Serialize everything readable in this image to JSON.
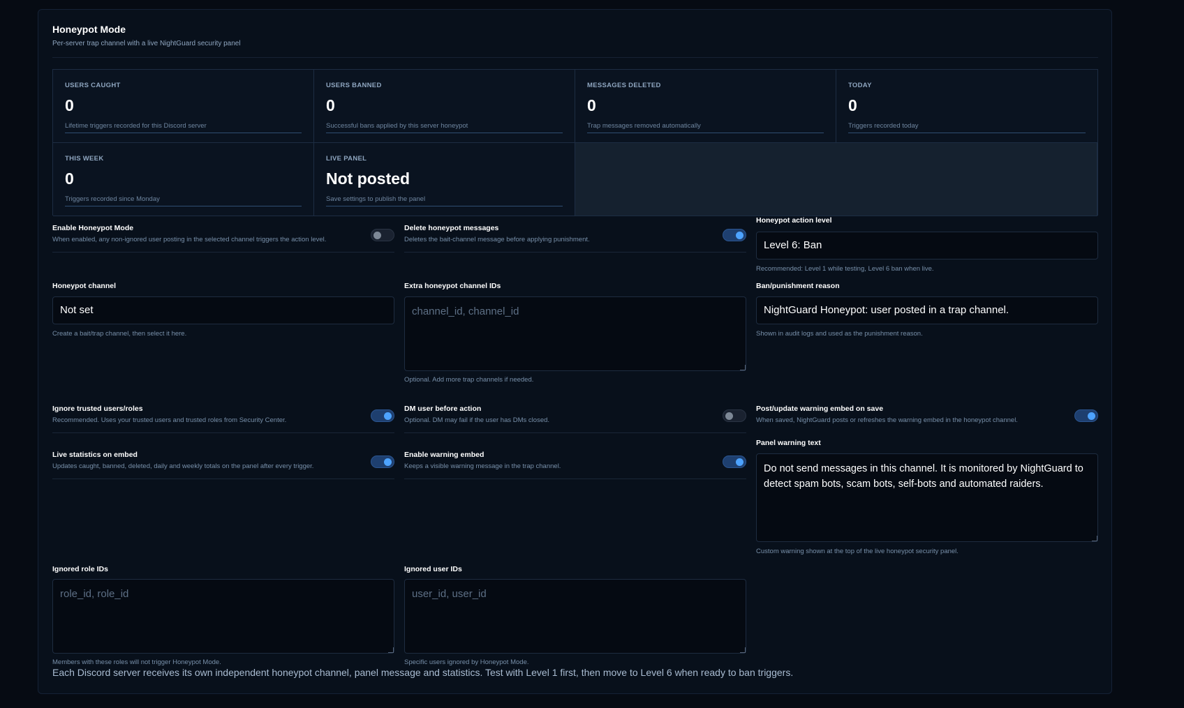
{
  "header": {
    "title": "Honeypot Mode",
    "subtitle": "Per-server trap channel with a live NightGuard security panel"
  },
  "stats": [
    {
      "label": "USERS CAUGHT",
      "value": "0",
      "desc": "Lifetime triggers recorded for this Discord server"
    },
    {
      "label": "USERS BANNED",
      "value": "0",
      "desc": "Successful bans applied by this server honeypot"
    },
    {
      "label": "MESSAGES DELETED",
      "value": "0",
      "desc": "Trap messages removed automatically"
    },
    {
      "label": "TODAY",
      "value": "0",
      "desc": "Triggers recorded today"
    },
    {
      "label": "THIS WEEK",
      "value": "0",
      "desc": "Triggers recorded since Monday"
    },
    {
      "label": "LIVE PANEL",
      "value": "Not posted",
      "desc": "Save settings to publish the panel"
    }
  ],
  "toggles": {
    "enable_honeypot": {
      "label": "Enable Honeypot Mode",
      "hint": "When enabled, any non-ignored user posting in the selected channel triggers the action level.",
      "on": false
    },
    "delete_messages": {
      "label": "Delete honeypot messages",
      "hint": "Deletes the bait-channel message before applying punishment.",
      "on": true
    },
    "ignore_trusted": {
      "label": "Ignore trusted users/roles",
      "hint": "Recommended. Uses your trusted users and trusted roles from Security Center.",
      "on": true
    },
    "dm_user": {
      "label": "DM user before action",
      "hint": "Optional. DM may fail if the user has DMs closed.",
      "on": false
    },
    "post_warning": {
      "label": "Post/update warning embed on save",
      "hint": "When saved, NightGuard posts or refreshes the warning embed in the honeypot channel.",
      "on": true
    },
    "live_stats": {
      "label": "Live statistics on embed",
      "hint": "Updates caught, banned, deleted, daily and weekly totals on the panel after every trigger.",
      "on": true
    },
    "warning_embed": {
      "label": "Enable warning embed",
      "hint": "Keeps a visible warning message in the trap channel.",
      "on": true
    }
  },
  "fields": {
    "action_level": {
      "label": "Honeypot action level",
      "value": "Level 6: Ban",
      "hint": "Recommended: Level 1 while testing, Level 6 ban when live."
    },
    "channel": {
      "label": "Honeypot channel",
      "value": "Not set",
      "hint": "Create a bait/trap channel, then select it here."
    },
    "extra_channels": {
      "label": "Extra honeypot channel IDs",
      "placeholder": "channel_id, channel_id",
      "hint": "Optional. Add more trap channels if needed."
    },
    "reason": {
      "label": "Ban/punishment reason",
      "value": "NightGuard Honeypot: user posted in a trap channel.",
      "hint": "Shown in audit logs and used as the punishment reason."
    },
    "warning_text": {
      "label": "Panel warning text",
      "value": "Do not send messages in this channel. It is monitored by NightGuard to detect spam bots, scam bots, self-bots and automated raiders.",
      "hint": "Custom warning shown at the top of the live honeypot security panel."
    },
    "ignored_roles": {
      "label": "Ignored role IDs",
      "placeholder": "role_id, role_id",
      "hint": "Members with these roles will not trigger Honeypot Mode."
    },
    "ignored_users": {
      "label": "Ignored user IDs",
      "placeholder": "user_id, user_id",
      "hint": "Specific users ignored by Honeypot Mode."
    }
  },
  "footer": {
    "note": "Each Discord server receives its own independent honeypot channel, panel message and statistics. Test with Level 1 first, then move to Level 6 when ready to ban triggers."
  }
}
